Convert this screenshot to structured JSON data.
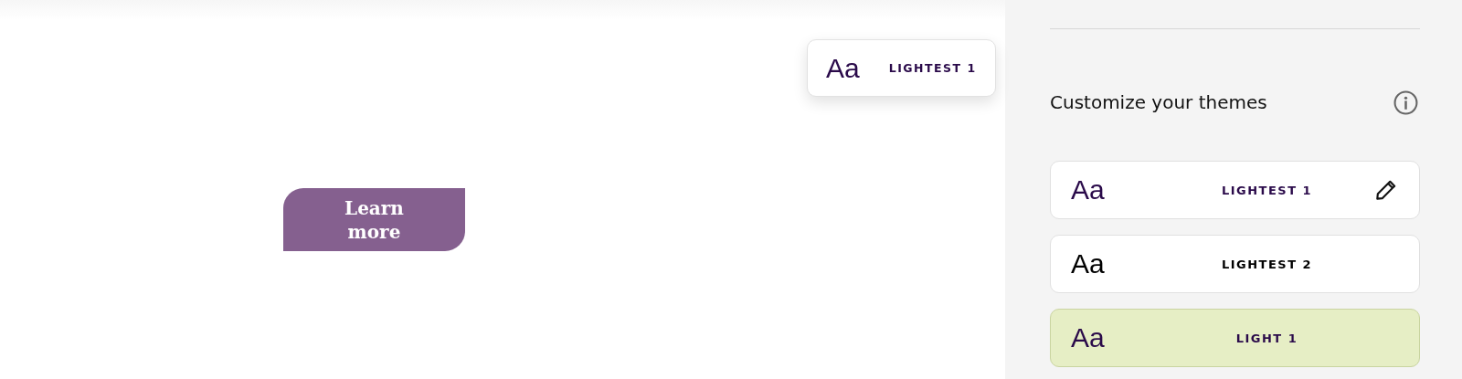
{
  "canvas": {
    "floating_theme": {
      "sample": "Aa",
      "label": "LIGHTEST 1",
      "color": "#2a0a4a"
    },
    "button": {
      "label": "Learn more"
    }
  },
  "panel": {
    "title": "Customize your themes",
    "themes": [
      {
        "sample": "Aa",
        "label": "LIGHTEST 1",
        "color": "#2a0a4a",
        "selected": false,
        "editable": true
      },
      {
        "sample": "Aa",
        "label": "LIGHTEST 2",
        "color": "#000000",
        "selected": false,
        "editable": false
      },
      {
        "sample": "Aa",
        "label": "LIGHT 1",
        "color": "#2a0a4a",
        "selected": true,
        "editable": false
      }
    ]
  }
}
